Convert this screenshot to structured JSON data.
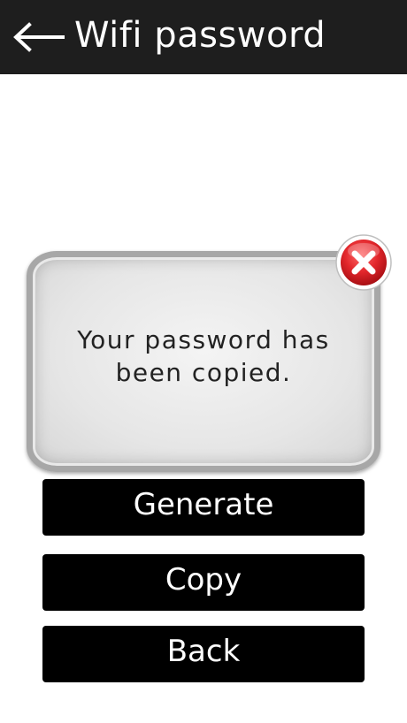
{
  "header": {
    "title": "Wifi password",
    "back_icon": "back-arrow-icon"
  },
  "dialog": {
    "message": "Your password has been copied.",
    "close_icon": "close-icon"
  },
  "buttons": {
    "generate": "Generate",
    "copy": "Copy",
    "back": "Back"
  },
  "colors": {
    "header_bg": "#1e1e1e",
    "button_bg": "#000000",
    "close_red": "#d9262a",
    "dialog_border": "#a7a7a7"
  }
}
